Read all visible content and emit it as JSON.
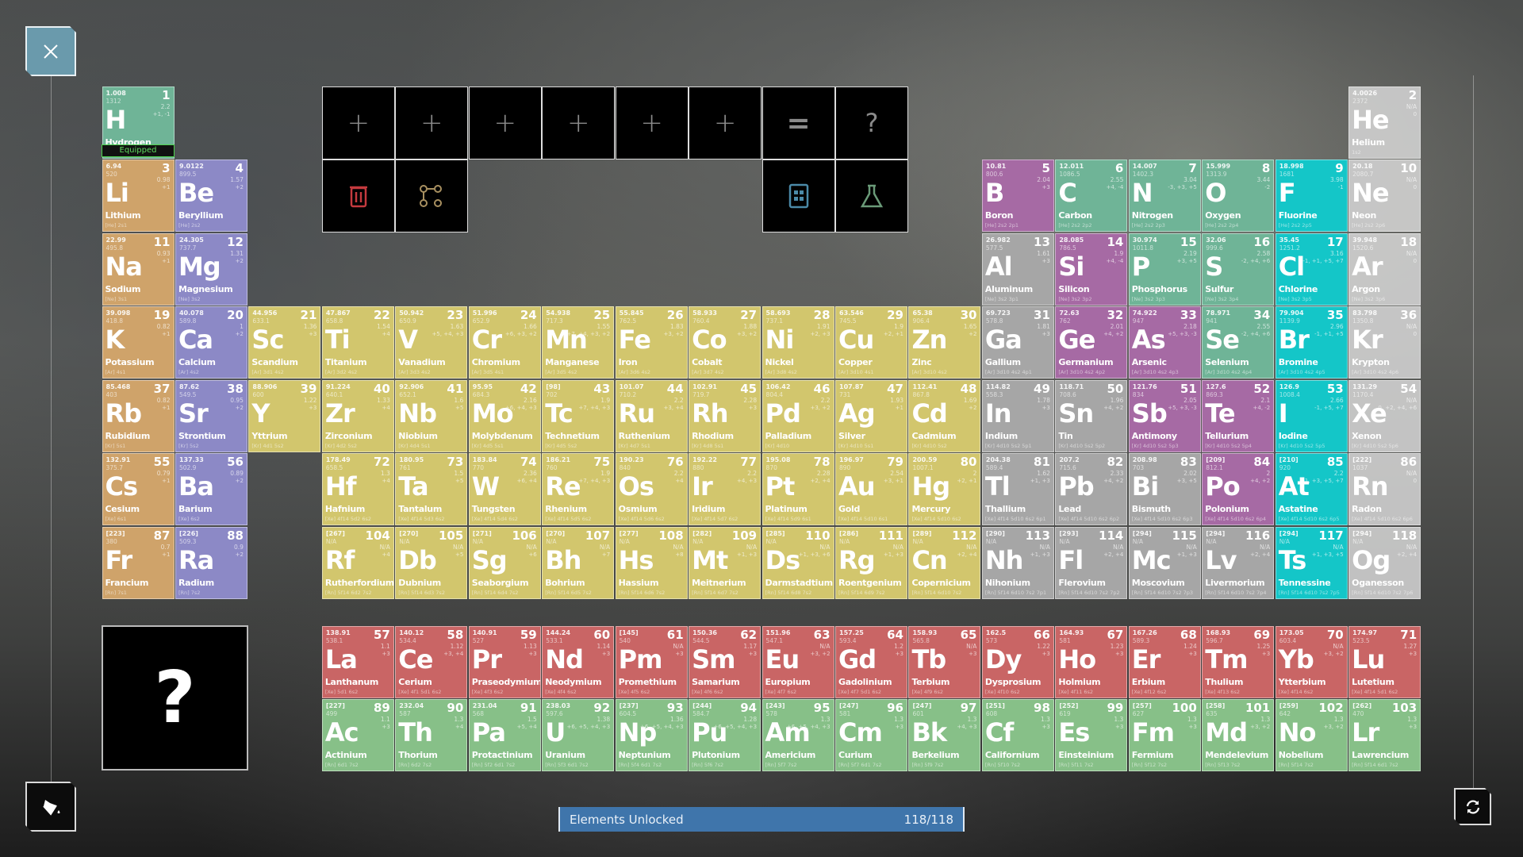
{
  "toolbar": {
    "slots": [
      "+",
      "+",
      "+",
      "+",
      "+",
      "+"
    ],
    "equals": "=",
    "result": "?"
  },
  "equipped_label": "Equipped",
  "mystery_box": "?",
  "progress": {
    "label": "Elements Unlocked",
    "value": "118/118",
    "fraction": 1.0
  },
  "colors": {
    "a": "#cfa36a",
    "e": "#8c89c6",
    "t": "#d2c66d",
    "p": "#a6a6a6",
    "m": "#a66aa4",
    "n": "#6fb497",
    "h": "#14c6c8",
    "g": "#c9c9c9",
    "l": "#c96565",
    "c": "#87c088",
    "accent": "#3f75ab",
    "equipped": "#4fd24f"
  },
  "elements": [
    [
      1,
      "H",
      "Hydrogen",
      "1.008",
      "1312",
      "2.2",
      "+1, -1",
      "1s1",
      "n"
    ],
    [
      2,
      "He",
      "Helium",
      "4.0026",
      "2372",
      "N/A",
      "0",
      "1s2",
      "g"
    ],
    [
      3,
      "Li",
      "Lithium",
      "6.94",
      "520",
      "0.98",
      "+1",
      "[He] 2s1",
      "a"
    ],
    [
      4,
      "Be",
      "Beryllium",
      "9.0122",
      "899.5",
      "1.57",
      "+2",
      "[He] 2s2",
      "e"
    ],
    [
      5,
      "B",
      "Boron",
      "10.81",
      "800.6",
      "2.04",
      "+3",
      "[He] 2s2 2p1",
      "m"
    ],
    [
      6,
      "C",
      "Carbon",
      "12.011",
      "1086.5",
      "2.55",
      "+4, -4",
      "[He] 2s2 2p2",
      "n"
    ],
    [
      7,
      "N",
      "Nitrogen",
      "14.007",
      "1402.3",
      "3.04",
      "-3, +3, +5",
      "[He] 2s2 2p3",
      "n"
    ],
    [
      8,
      "O",
      "Oxygen",
      "15.999",
      "1313.9",
      "3.44",
      "-2",
      "[He] 2s2 2p4",
      "n"
    ],
    [
      9,
      "F",
      "Fluorine",
      "18.998",
      "1681",
      "3.98",
      "-1",
      "[He] 2s2 2p5",
      "h"
    ],
    [
      10,
      "Ne",
      "Neon",
      "20.18",
      "2080.7",
      "N/A",
      "0",
      "[He] 2s2 2p6",
      "g"
    ],
    [
      11,
      "Na",
      "Sodium",
      "22.99",
      "495.8",
      "0.93",
      "+1",
      "[Ne] 3s1",
      "a"
    ],
    [
      12,
      "Mg",
      "Magnesium",
      "24.305",
      "737.7",
      "1.31",
      "+2",
      "[Ne] 3s2",
      "e"
    ],
    [
      13,
      "Al",
      "Aluminum",
      "26.982",
      "577.5",
      "1.61",
      "+3",
      "[Ne] 3s2 3p1",
      "p"
    ],
    [
      14,
      "Si",
      "Silicon",
      "28.085",
      "786.5",
      "1.9",
      "+4, -4",
      "[Ne] 3s2 3p2",
      "m"
    ],
    [
      15,
      "P",
      "Phosphorus",
      "30.974",
      "1011.8",
      "2.19",
      "+3, +5",
      "[Ne] 3s2 3p3",
      "n"
    ],
    [
      16,
      "S",
      "Sulfur",
      "32.06",
      "999.6",
      "2.58",
      "-2, +4, +6",
      "[Ne] 3s2 3p4",
      "n"
    ],
    [
      17,
      "Cl",
      "Chlorine",
      "35.45",
      "1251.2",
      "3.16",
      "-1, +1, +5, +7",
      "[Ne] 3s2 3p5",
      "h"
    ],
    [
      18,
      "Ar",
      "Argon",
      "39.948",
      "1520.6",
      "N/A",
      "0",
      "[Ne] 3s2 3p6",
      "g"
    ],
    [
      19,
      "K",
      "Potassium",
      "39.098",
      "418.8",
      "0.82",
      "+1",
      "[Ar] 4s1",
      "a"
    ],
    [
      20,
      "Ca",
      "Calcium",
      "40.078",
      "589.8",
      "1",
      "+2",
      "[Ar] 4s2",
      "e"
    ],
    [
      21,
      "Sc",
      "Scandium",
      "44.956",
      "633.1",
      "1.36",
      "+3",
      "[Ar] 3d1 4s2",
      "t"
    ],
    [
      22,
      "Ti",
      "Titanium",
      "47.867",
      "658.8",
      "1.54",
      "+4",
      "[Ar] 3d2 4s2",
      "t"
    ],
    [
      23,
      "V",
      "Vanadium",
      "50.942",
      "650.9",
      "1.63",
      "+5, +4, +3",
      "[Ar] 3d3 4s2",
      "t"
    ],
    [
      24,
      "Cr",
      "Chromium",
      "51.996",
      "652.9",
      "1.66",
      "+6, +3, +2",
      "[Ar] 3d5 4s1",
      "t"
    ],
    [
      25,
      "Mn",
      "Manganese",
      "54.938",
      "717.3",
      "1.55",
      "+7, +4, +3, +2",
      "[Ar] 3d5 4s2",
      "t"
    ],
    [
      26,
      "Fe",
      "Iron",
      "55.845",
      "762.5",
      "1.83",
      "+3, +2",
      "[Ar] 3d6 4s2",
      "t"
    ],
    [
      27,
      "Co",
      "Cobalt",
      "58.933",
      "760.4",
      "1.88",
      "+3, +2",
      "[Ar] 3d7 4s2",
      "t"
    ],
    [
      28,
      "Ni",
      "Nickel",
      "58.693",
      "737.1",
      "1.91",
      "+2, +3",
      "[Ar] 3d8 4s2",
      "t"
    ],
    [
      29,
      "Cu",
      "Copper",
      "63.546",
      "745.5",
      "1.9",
      "+2, +1",
      "[Ar] 3d10 4s1",
      "t"
    ],
    [
      30,
      "Zn",
      "Zinc",
      "65.38",
      "906.4",
      "1.65",
      "+2",
      "[Ar] 3d10 4s2",
      "t"
    ],
    [
      31,
      "Ga",
      "Gallium",
      "69.723",
      "578.8",
      "1.81",
      "+3",
      "[Ar] 3d10 4s2 4p1",
      "p"
    ],
    [
      32,
      "Ge",
      "Germanium",
      "72.63",
      "762",
      "2.01",
      "+4, +2",
      "[Ar] 3d10 4s2 4p2",
      "m"
    ],
    [
      33,
      "As",
      "Arsenic",
      "74.922",
      "947",
      "2.18",
      "+5, +3, -3",
      "[Ar] 3d10 4s2 4p3",
      "m"
    ],
    [
      34,
      "Se",
      "Selenium",
      "78.971",
      "941",
      "2.55",
      "-2, +4, +6",
      "[Ar] 3d10 4s2 4p4",
      "n"
    ],
    [
      35,
      "Br",
      "Bromine",
      "79.904",
      "1139.9",
      "2.96",
      "-1, +1, +5",
      "[Ar] 3d10 4s2 4p5",
      "h"
    ],
    [
      36,
      "Kr",
      "Krypton",
      "83.798",
      "1350.8",
      "N/A",
      "0",
      "[Ar] 3d10 4s2 4p6",
      "g"
    ],
    [
      37,
      "Rb",
      "Rubidium",
      "85.468",
      "403",
      "0.82",
      "+1",
      "[Kr] 5s1",
      "a"
    ],
    [
      38,
      "Sr",
      "Strontium",
      "87.62",
      "549.5",
      "0.95",
      "+2",
      "[Kr] 5s2",
      "e"
    ],
    [
      39,
      "Y",
      "Yttrium",
      "88.906",
      "600",
      "1.22",
      "+3",
      "[Kr] 4d1 5s2",
      "t"
    ],
    [
      40,
      "Zr",
      "Zirconium",
      "91.224",
      "640.1",
      "1.33",
      "+4",
      "[Kr] 4d2 5s2",
      "t"
    ],
    [
      41,
      "Nb",
      "Niobium",
      "92.906",
      "652.1",
      "1.6",
      "+5",
      "[Kr] 4d4 5s1",
      "t"
    ],
    [
      42,
      "Mo",
      "Molybdenum",
      "95.95",
      "684.3",
      "2.16",
      "+6, +4, +3",
      "[Kr] 4d5 5s1",
      "t"
    ],
    [
      43,
      "Tc",
      "Technetium",
      "[98]",
      "702",
      "1.9",
      "+7, +4, +3",
      "[Kr] 4d5 5s2",
      "t"
    ],
    [
      44,
      "Ru",
      "Ruthenium",
      "101.07",
      "710.2",
      "2.2",
      "+3, +4",
      "[Kr] 4d7 5s1",
      "t"
    ],
    [
      45,
      "Rh",
      "Rhodium",
      "102.91",
      "719.7",
      "2.28",
      "+3",
      "[Kr] 4d8 5s1",
      "t"
    ],
    [
      46,
      "Pd",
      "Palladium",
      "106.42",
      "804.4",
      "2.2",
      "+3, +2",
      "[Kr] 4d10",
      "t"
    ],
    [
      47,
      "Ag",
      "Silver",
      "107.87",
      "731",
      "1.93",
      "+1",
      "[Kr] 4d10 5s1",
      "t"
    ],
    [
      48,
      "Cd",
      "Cadmium",
      "112.41",
      "867.8",
      "1.69",
      "+2",
      "[Kr] 4d10 5s2",
      "t"
    ],
    [
      49,
      "In",
      "Indium",
      "114.82",
      "558.3",
      "1.78",
      "+3",
      "[Kr] 4d10 5s2 5p1",
      "p"
    ],
    [
      50,
      "Sn",
      "Tin",
      "118.71",
      "708.6",
      "1.96",
      "+4, +2",
      "[Kr] 4d10 5s2 5p2",
      "p"
    ],
    [
      51,
      "Sb",
      "Antimony",
      "121.76",
      "834",
      "2.05",
      "+5, +3, -3",
      "[Kr] 4d10 5s2 5p3",
      "m"
    ],
    [
      52,
      "Te",
      "Tellurium",
      "127.6",
      "869.3",
      "2.1",
      "+4, -2",
      "[Kr] 4d10 5s2 5p4",
      "m"
    ],
    [
      53,
      "I",
      "Iodine",
      "126.9",
      "1008.4",
      "2.66",
      "-1, +5, +7",
      "[Kr] 4d10 5s2 5p5",
      "h"
    ],
    [
      54,
      "Xe",
      "Xenon",
      "131.29",
      "1170.4",
      "N/A",
      "0, +2, +4, +6",
      "[Kr] 4d10 5s2 5p6",
      "g"
    ],
    [
      55,
      "Cs",
      "Cesium",
      "132.91",
      "375.7",
      "0.79",
      "+1",
      "[Xe] 6s1",
      "a"
    ],
    [
      56,
      "Ba",
      "Barium",
      "137.33",
      "502.9",
      "0.89",
      "+2",
      "[Xe] 6s2",
      "e"
    ],
    [
      57,
      "La",
      "Lanthanum",
      "138.91",
      "538.1",
      "1.1",
      "+3",
      "[Xe] 5d1 6s2",
      "l"
    ],
    [
      58,
      "Ce",
      "Cerium",
      "140.12",
      "534.4",
      "1.12",
      "+3, +4",
      "[Xe] 4f1 5d1 6s2",
      "l"
    ],
    [
      59,
      "Pr",
      "Praseodymium",
      "140.91",
      "527",
      "1.13",
      "+3",
      "[Xe] 4f3 6s2",
      "l"
    ],
    [
      60,
      "Nd",
      "Neodymium",
      "144.24",
      "533.1",
      "1.14",
      "+3",
      "[Xe] 4f4 6s2",
      "l"
    ],
    [
      61,
      "Pm",
      "Promethium",
      "[145]",
      "540",
      "N/A",
      "+3",
      "[Xe] 4f5 6s2",
      "l"
    ],
    [
      62,
      "Sm",
      "Samarium",
      "150.36",
      "544.5",
      "1.17",
      "+3",
      "[Xe] 4f6 6s2",
      "l"
    ],
    [
      63,
      "Eu",
      "Europium",
      "151.96",
      "547.1",
      "N/A",
      "+3, +2",
      "[Xe] 4f7 6s2",
      "l"
    ],
    [
      64,
      "Gd",
      "Gadolinium",
      "157.25",
      "593.4",
      "1.2",
      "+3",
      "[Xe] 4f7 5d1 6s2",
      "l"
    ],
    [
      65,
      "Tb",
      "Terbium",
      "158.93",
      "565.8",
      "N/A",
      "+3",
      "[Xe] 4f9 6s2",
      "l"
    ],
    [
      66,
      "Dy",
      "Dysprosium",
      "162.5",
      "573",
      "1.22",
      "+3",
      "[Xe] 4f10 6s2",
      "l"
    ],
    [
      67,
      "Ho",
      "Holmium",
      "164.93",
      "581",
      "1.23",
      "+3",
      "[Xe] 4f11 6s2",
      "l"
    ],
    [
      68,
      "Er",
      "Erbium",
      "167.26",
      "589.3",
      "1.24",
      "+3",
      "[Xe] 4f12 6s2",
      "l"
    ],
    [
      69,
      "Tm",
      "Thulium",
      "168.93",
      "596.7",
      "1.25",
      "+3",
      "[Xe] 4f13 6s2",
      "l"
    ],
    [
      70,
      "Yb",
      "Ytterbium",
      "173.05",
      "603.4",
      "N/A",
      "+3, +2",
      "[Xe] 4f14 6s2",
      "l"
    ],
    [
      71,
      "Lu",
      "Lutetium",
      "174.97",
      "523.5",
      "1.27",
      "+3",
      "[Xe] 4f14 5d1 6s2",
      "l"
    ],
    [
      72,
      "Hf",
      "Hafnium",
      "178.49",
      "658.5",
      "1.3",
      "+4",
      "[Xe] 4f14 5d2 6s2",
      "t"
    ],
    [
      73,
      "Ta",
      "Tantalum",
      "180.95",
      "761",
      "1.5",
      "+5",
      "[Xe] 4f14 5d3 6s2",
      "t"
    ],
    [
      74,
      "W",
      "Tungsten",
      "183.84",
      "770",
      "2.36",
      "+6, +4",
      "[Xe] 4f14 5d4 6s2",
      "t"
    ],
    [
      75,
      "Re",
      "Rhenium",
      "186.21",
      "760",
      "1.9",
      "+7, +4, +3",
      "[Xe] 4f14 5d5 6s2",
      "t"
    ],
    [
      76,
      "Os",
      "Osmium",
      "190.23",
      "840",
      "2.2",
      "+4",
      "[Xe] 4f14 5d6 6s2",
      "t"
    ],
    [
      77,
      "Ir",
      "Iridium",
      "192.22",
      "880",
      "2.2",
      "+4, +3",
      "[Xe] 4f14 5d7 6s2",
      "t"
    ],
    [
      78,
      "Pt",
      "Platinum",
      "195.08",
      "870",
      "2.28",
      "+2, +4",
      "[Xe] 4f14 5d9 6s1",
      "t"
    ],
    [
      79,
      "Au",
      "Gold",
      "196.97",
      "890",
      "2.54",
      "+3, +1",
      "[Xe] 4f14 5d10 6s1",
      "t"
    ],
    [
      80,
      "Hg",
      "Mercury",
      "200.59",
      "1007.1",
      "2",
      "+2, +1",
      "[Xe] 4f14 5d10 6s2",
      "t"
    ],
    [
      81,
      "Tl",
      "Thallium",
      "204.38",
      "589.4",
      "1.62",
      "+1, +3",
      "[Xe] 4f14 5d10 6s2 6p1",
      "p"
    ],
    [
      82,
      "Pb",
      "Lead",
      "207.2",
      "715.6",
      "2.33",
      "+4, +2",
      "[Xe] 4f14 5d10 6s2 6p2",
      "p"
    ],
    [
      83,
      "Bi",
      "Bismuth",
      "208.98",
      "703",
      "2.02",
      "+3, +5",
      "[Xe] 4f14 5d10 6s2 6p3",
      "p"
    ],
    [
      84,
      "Po",
      "Polonium",
      "[209]",
      "812.1",
      "2",
      "+4, +2",
      "[Xe] 4f14 5d10 6s2 6p4",
      "m"
    ],
    [
      85,
      "At",
      "Astatine",
      "[210]",
      "920",
      "2.2",
      "+1, +3, +5, +7",
      "[Xe] 4f14 5d10 6s2 6p5",
      "h"
    ],
    [
      86,
      "Rn",
      "Radon",
      "[222]",
      "1037",
      "N/A",
      "0",
      "[Xe] 4f14 5d10 6s2 6p6",
      "g"
    ],
    [
      87,
      "Fr",
      "Francium",
      "[223]",
      "380",
      "0.7",
      "+1",
      "[Rn] 7s1",
      "a"
    ],
    [
      88,
      "Ra",
      "Radium",
      "[226]",
      "509.3",
      "0.9",
      "+2",
      "[Rn] 7s2",
      "e"
    ],
    [
      89,
      "Ac",
      "Actinium",
      "[227]",
      "499",
      "1.1",
      "+3",
      "[Rn] 6d1 7s2",
      "c"
    ],
    [
      90,
      "Th",
      "Thorium",
      "232.04",
      "587",
      "1.3",
      "+4",
      "[Rn] 6d2 7s2",
      "c"
    ],
    [
      91,
      "Pa",
      "Protactinium",
      "231.04",
      "568",
      "1.5",
      "+5, +4",
      "[Rn] 5f2 6d1 7s2",
      "c"
    ],
    [
      92,
      "U",
      "Uranium",
      "238.03",
      "597.6",
      "1.38",
      "+6, +5, +4, +3",
      "[Rn] 5f3 6d1 7s2",
      "c"
    ],
    [
      93,
      "Np",
      "Neptunium",
      "[237]",
      "604.5",
      "1.36",
      "+6, +5, +4, +3",
      "[Rn] 5f4 6d1 7s2",
      "c"
    ],
    [
      94,
      "Pu",
      "Plutonium",
      "[244]",
      "584.7",
      "1.28",
      "+6, +5, +4, +3",
      "[Rn] 5f6 7s2",
      "c"
    ],
    [
      95,
      "Am",
      "Americium",
      "[243]",
      "578",
      "1.3",
      "+6, +5, +4, +3",
      "[Rn] 5f7 7s2",
      "c"
    ],
    [
      96,
      "Cm",
      "Curium",
      "[247]",
      "581",
      "1.3",
      "+3",
      "[Rn] 5f7 6d1 7s2",
      "c"
    ],
    [
      97,
      "Bk",
      "Berkelium",
      "[247]",
      "601",
      "1.3",
      "+4, +3",
      "[Rn] 5f9 7s2",
      "c"
    ],
    [
      98,
      "Cf",
      "Californium",
      "[251]",
      "608",
      "1.3",
      "+3",
      "[Rn] 5f10 7s2",
      "c"
    ],
    [
      99,
      "Es",
      "Einsteinium",
      "[252]",
      "619",
      "1.3",
      "+3",
      "[Rn] 5f11 7s2",
      "c"
    ],
    [
      100,
      "Fm",
      "Fermium",
      "[257]",
      "627",
      "1.3",
      "+3",
      "[Rn] 5f12 7s2",
      "c"
    ],
    [
      101,
      "Md",
      "Mendelevium",
      "[258]",
      "635",
      "1.3",
      "+3, +2",
      "[Rn] 5f13 7s2",
      "c"
    ],
    [
      102,
      "No",
      "Nobelium",
      "[259]",
      "642",
      "1.3",
      "+3, +2",
      "[Rn] 5f14 7s2",
      "c"
    ],
    [
      103,
      "Lr",
      "Lawrencium",
      "[262]",
      "470",
      "1.3",
      "+3",
      "[Rn] 5f14 6d1 7s2",
      "c"
    ],
    [
      104,
      "Rf",
      "Rutherfordium",
      "[267]",
      "N/A",
      "N/A",
      "+4",
      "[Rn] 5f14 6d2 7s2",
      "t"
    ],
    [
      105,
      "Db",
      "Dubnium",
      "[270]",
      "N/A",
      "N/A",
      "+5",
      "[Rn] 5f14 6d3 7s2",
      "t"
    ],
    [
      106,
      "Sg",
      "Seaborgium",
      "[271]",
      "N/A",
      "N/A",
      "+6",
      "[Rn] 5f14 6d4 7s2",
      "t"
    ],
    [
      107,
      "Bh",
      "Bohrium",
      "[270]",
      "N/A",
      "N/A",
      "+7",
      "[Rn] 5f14 6d5 7s2",
      "t"
    ],
    [
      108,
      "Hs",
      "Hassium",
      "[277]",
      "N/A",
      "N/A",
      "+8",
      "[Rn] 5f14 6d6 7s2",
      "t"
    ],
    [
      109,
      "Mt",
      "Meitnerium",
      "[282]",
      "N/A",
      "N/A",
      "+1, +3",
      "[Rn] 5f14 6d7 7s2",
      "t"
    ],
    [
      110,
      "Ds",
      "Darmstadtium",
      "[285]",
      "N/A",
      "N/A",
      "+1, +3, +6",
      "[Rn] 5f14 6d8 7s2",
      "t"
    ],
    [
      111,
      "Rg",
      "Roentgenium",
      "[286]",
      "N/A",
      "N/A",
      "+1, +3",
      "[Rn] 5f14 6d9 7s2",
      "t"
    ],
    [
      112,
      "Cn",
      "Copernicium",
      "[289]",
      "N/A",
      "N/A",
      "+2, +4",
      "[Rn] 5f14 6d10 7s2",
      "t"
    ],
    [
      113,
      "Nh",
      "Nihonium",
      "[290]",
      "N/A",
      "N/A",
      "+1, +3",
      "[Rn] 5f14 6d10 7s2 7p1",
      "p"
    ],
    [
      114,
      "Fl",
      "Flerovium",
      "[293]",
      "N/A",
      "N/A",
      "+2, +4",
      "[Rn] 5f14 6d10 7s2 7p2",
      "p"
    ],
    [
      115,
      "Mc",
      "Moscovium",
      "[294]",
      "N/A",
      "N/A",
      "+1, +3",
      "[Rn] 5f14 6d10 7s2 7p3",
      "p"
    ],
    [
      116,
      "Lv",
      "Livermorium",
      "[294]",
      "N/A",
      "N/A",
      "+2, +4",
      "[Rn] 5f14 6d10 7s2 7p4",
      "p"
    ],
    [
      117,
      "Ts",
      "Tennessine",
      "[294]",
      "N/A",
      "N/A",
      "+1, +3, +5",
      "[Rn] 5f14 6d10 7s2 7p5",
      "h"
    ],
    [
      118,
      "Og",
      "Oganesson",
      "[294]",
      "N/A",
      "N/A",
      "+2, +4",
      "[Rn] 5f14 6d10 7s2 7p6",
      "g"
    ]
  ]
}
